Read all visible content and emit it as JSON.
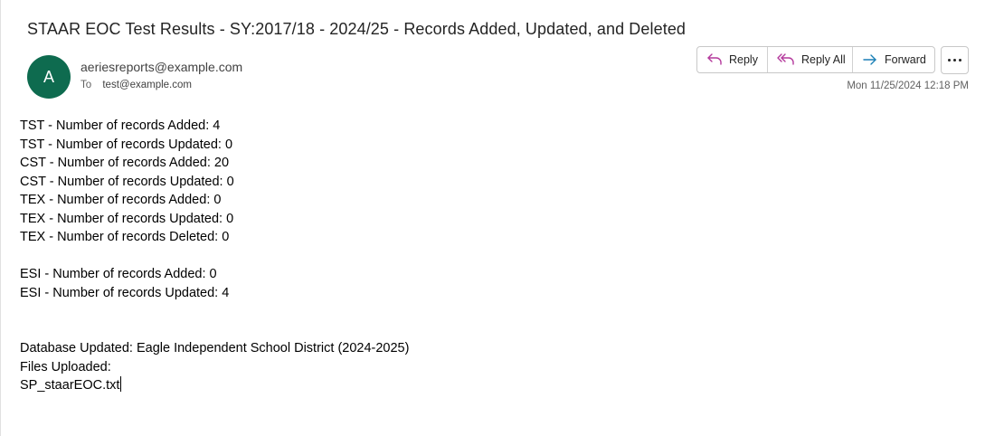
{
  "email": {
    "subject": "STAAR EOC Test Results - SY:2017/18 - 2024/25 - Records Added, Updated, and Deleted",
    "avatar_initial": "A",
    "avatar_color": "#0e6b4f",
    "from": "aeriesreports@example.com",
    "to_label": "To",
    "to": "test@example.com",
    "timestamp": "Mon 11/25/2024 12:18 PM"
  },
  "actions": {
    "reply": "Reply",
    "reply_all": "Reply All",
    "forward": "Forward",
    "more_icon": "more-horizontal-icon"
  },
  "body": {
    "group1": [
      "TST - Number of records Added: 4",
      "TST - Number of records Updated: 0",
      "CST - Number of records Added: 20",
      "CST - Number of records Updated: 0",
      "TEX - Number of records Added: 0",
      "TEX - Number of records Updated: 0",
      "TEX - Number of records Deleted: 0"
    ],
    "group2": [
      "ESI - Number of records Added: 0",
      "ESI - Number of records Updated: 4"
    ],
    "group3": [
      "Database Updated: Eagle Independent School District (2024-2025)",
      "Files Uploaded:",
      "SP_staarEOC.txt"
    ]
  },
  "colors": {
    "reply_icon": "#b4399c",
    "forward_icon": "#1a7fb5"
  }
}
